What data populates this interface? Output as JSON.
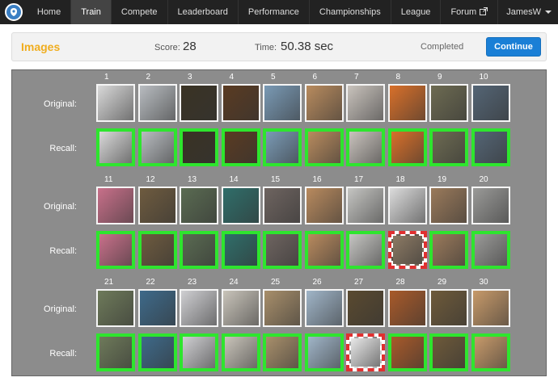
{
  "nav": {
    "items": [
      {
        "label": "Home",
        "active": false
      },
      {
        "label": "Train",
        "active": true
      },
      {
        "label": "Compete",
        "active": false
      },
      {
        "label": "Leaderboard",
        "active": false
      },
      {
        "label": "Performance",
        "active": false
      },
      {
        "label": "Championships",
        "active": false
      },
      {
        "label": "League",
        "active": false
      },
      {
        "label": "Forum",
        "active": false
      }
    ],
    "user": "JamesW",
    "logo_icon": "brain-shield-icon",
    "external_icon": "external-link-icon"
  },
  "header": {
    "title": "Images",
    "score_label": "Score:",
    "score": "28",
    "time_label": "Time:",
    "time": "50.38 sec",
    "status": "Completed",
    "continue_label": "Continue"
  },
  "grid": {
    "row_labels": {
      "original": "Original:",
      "recall": "Recall:"
    },
    "blocks": [
      {
        "numbers": [
          "1",
          "2",
          "3",
          "4",
          "5",
          "6",
          "7",
          "8",
          "9",
          "10"
        ],
        "original": [
          {
            "subject": "sleeping baby b&w",
            "color": "#d9d9d9"
          },
          {
            "subject": "urinals",
            "color": "#b8bcc0"
          },
          {
            "subject": "night street",
            "color": "#3a3324"
          },
          {
            "subject": "coffee beans spoon",
            "color": "#5a3b22"
          },
          {
            "subject": "stone figure blue sky",
            "color": "#7a9ab5"
          },
          {
            "subject": "guitar player",
            "color": "#b88b5e"
          },
          {
            "subject": "scissors",
            "color": "#c9c3bd"
          },
          {
            "subject": "carrots",
            "color": "#d8702a"
          },
          {
            "subject": "garden ruins",
            "color": "#6d6b52"
          },
          {
            "subject": "swans on water",
            "color": "#546575"
          }
        ],
        "recall": [
          {
            "status": "correct",
            "color": "#d9d9d9"
          },
          {
            "status": "correct",
            "color": "#b8bcc0"
          },
          {
            "status": "correct",
            "color": "#3a3324"
          },
          {
            "status": "correct",
            "color": "#5a3b22"
          },
          {
            "status": "correct",
            "color": "#7a9ab5"
          },
          {
            "status": "correct",
            "color": "#b88b5e"
          },
          {
            "status": "correct",
            "color": "#c9c3bd"
          },
          {
            "status": "correct",
            "color": "#d8702a"
          },
          {
            "status": "correct",
            "color": "#6d6b52"
          },
          {
            "status": "correct",
            "color": "#546575"
          }
        ]
      },
      {
        "numbers": [
          "11",
          "12",
          "13",
          "14",
          "15",
          "16",
          "17",
          "18",
          "19",
          "20"
        ],
        "original": [
          {
            "subject": "pink flower",
            "color": "#c8708a"
          },
          {
            "subject": "tabby cat",
            "color": "#6e5b3f"
          },
          {
            "subject": "helmet",
            "color": "#5a6b52"
          },
          {
            "subject": "food platter",
            "color": "#2f6e6a"
          },
          {
            "subject": "headphones",
            "color": "#6e6460"
          },
          {
            "subject": "cake",
            "color": "#b88a5e"
          },
          {
            "subject": "figure skaters snow",
            "color": "#c5c5c2"
          },
          {
            "subject": "skaters dark",
            "color": "#dcdcdc"
          },
          {
            "subject": "horse",
            "color": "#9a7a5b"
          },
          {
            "subject": "corridor",
            "color": "#9a9a98"
          }
        ],
        "recall": [
          {
            "status": "correct",
            "color": "#c8708a"
          },
          {
            "status": "correct",
            "color": "#6e5b3f"
          },
          {
            "status": "correct",
            "color": "#5a6b52"
          },
          {
            "status": "correct",
            "color": "#2f6e6a"
          },
          {
            "status": "correct",
            "color": "#6e6460"
          },
          {
            "status": "correct",
            "color": "#b88a5e"
          },
          {
            "status": "correct",
            "color": "#c5c5c2"
          },
          {
            "status": "wrong",
            "color": "#8c7a64"
          },
          {
            "status": "correct",
            "color": "#9a7a5b"
          },
          {
            "status": "correct",
            "color": "#9a9a98"
          }
        ]
      },
      {
        "numbers": [
          "21",
          "22",
          "23",
          "24",
          "25",
          "26",
          "27",
          "28",
          "29",
          "30"
        ],
        "original": [
          {
            "subject": "wisteria",
            "color": "#6e7a5a"
          },
          {
            "subject": "ocean waves",
            "color": "#3e6a8a"
          },
          {
            "subject": "toy figure",
            "color": "#cfcfd2"
          },
          {
            "subject": "seal on sand",
            "color": "#c9c4ba"
          },
          {
            "subject": "desert road",
            "color": "#a88f6b"
          },
          {
            "subject": "mosque domes",
            "color": "#a0b5c8"
          },
          {
            "subject": "iguana",
            "color": "#5a4a30"
          },
          {
            "subject": "campfire",
            "color": "#a85a2a"
          },
          {
            "subject": "horse riders",
            "color": "#6e5a3a"
          },
          {
            "subject": "food plate",
            "color": "#c79a6a"
          }
        ],
        "recall": [
          {
            "status": "correct",
            "color": "#6e7a5a"
          },
          {
            "status": "correct",
            "color": "#3e6a8a"
          },
          {
            "status": "correct",
            "color": "#cfcfd2"
          },
          {
            "status": "correct",
            "color": "#c9c4ba"
          },
          {
            "status": "correct",
            "color": "#a88f6b"
          },
          {
            "status": "correct",
            "color": "#a0b5c8"
          },
          {
            "status": "wrong",
            "color": "#e8e8e8"
          },
          {
            "status": "correct",
            "color": "#a85a2a"
          },
          {
            "status": "correct",
            "color": "#6e5a3a"
          },
          {
            "status": "correct",
            "color": "#c79a6a"
          }
        ]
      }
    ]
  }
}
